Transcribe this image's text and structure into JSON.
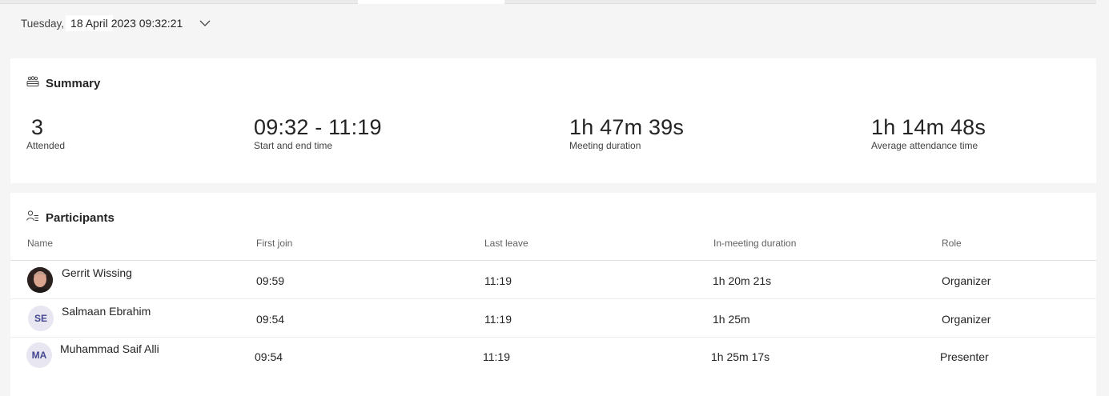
{
  "date_bar": {
    "weekday": "Tuesday,",
    "date": "18 April",
    "time": "2023 09:32:21",
    "dropdown_icon": "chevron-down-icon"
  },
  "summary": {
    "title": "Summary",
    "icon": "people-team-icon",
    "stats": [
      {
        "value": "3",
        "label": "Attended"
      },
      {
        "value": "09:32 - 11:19",
        "label": "Start and end time"
      },
      {
        "value": "1h 47m 39s",
        "label": "Meeting duration"
      },
      {
        "value": "1h 14m 48s",
        "label": "Average attendance time"
      }
    ]
  },
  "participants": {
    "title": "Participants",
    "icon": "people-list-icon",
    "columns": [
      "Name",
      "First join",
      "Last leave",
      "In-meeting duration",
      "Role"
    ],
    "rows": [
      {
        "initials": "",
        "name": "Gerrit Wissing",
        "first_join": "09:59",
        "last_leave": "11:19",
        "duration": "1h 20m 21s",
        "role": "Organizer"
      },
      {
        "initials": "SE",
        "name": "Salmaan Ebrahim",
        "first_join": "09:54",
        "last_leave": "11:19",
        "duration": "1h 25m",
        "role": "Organizer"
      },
      {
        "initials": "MA",
        "name": "Muhammad Saif Alli",
        "first_join": "09:54",
        "last_leave": "11:19",
        "duration": "1h 25m 17s",
        "role": "Presenter"
      }
    ]
  },
  "colors": {
    "page_bg": "#f5f5f5",
    "card_bg": "#ffffff",
    "avatar_bg": "#e8e6f1",
    "avatar_text": "#444791"
  }
}
